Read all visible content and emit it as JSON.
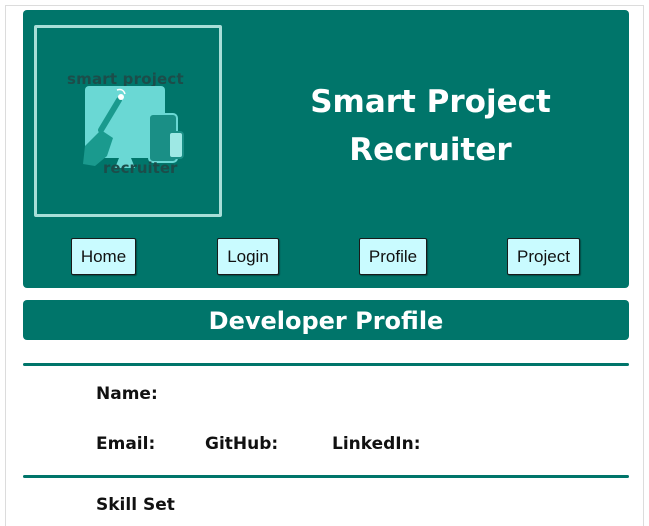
{
  "header": {
    "title_line1": "Smart Project",
    "title_line2": "Recruiter",
    "logo": {
      "top_text": "smart project",
      "bottom_text": "recruiter"
    }
  },
  "nav": {
    "items": [
      {
        "label": "Home"
      },
      {
        "label": "Login"
      },
      {
        "label": "Profile"
      },
      {
        "label": "Project"
      }
    ]
  },
  "page": {
    "heading": "Developer Profile"
  },
  "profile": {
    "name_label": "Name:",
    "email_label": "Email:",
    "github_label": "GitHub:",
    "linkedin_label": "LinkedIn:",
    "skills_label": "Skill Set"
  },
  "colors": {
    "primary": "#00756a",
    "button_bg": "#c9fbff",
    "logo_border": "#a8ded8"
  }
}
